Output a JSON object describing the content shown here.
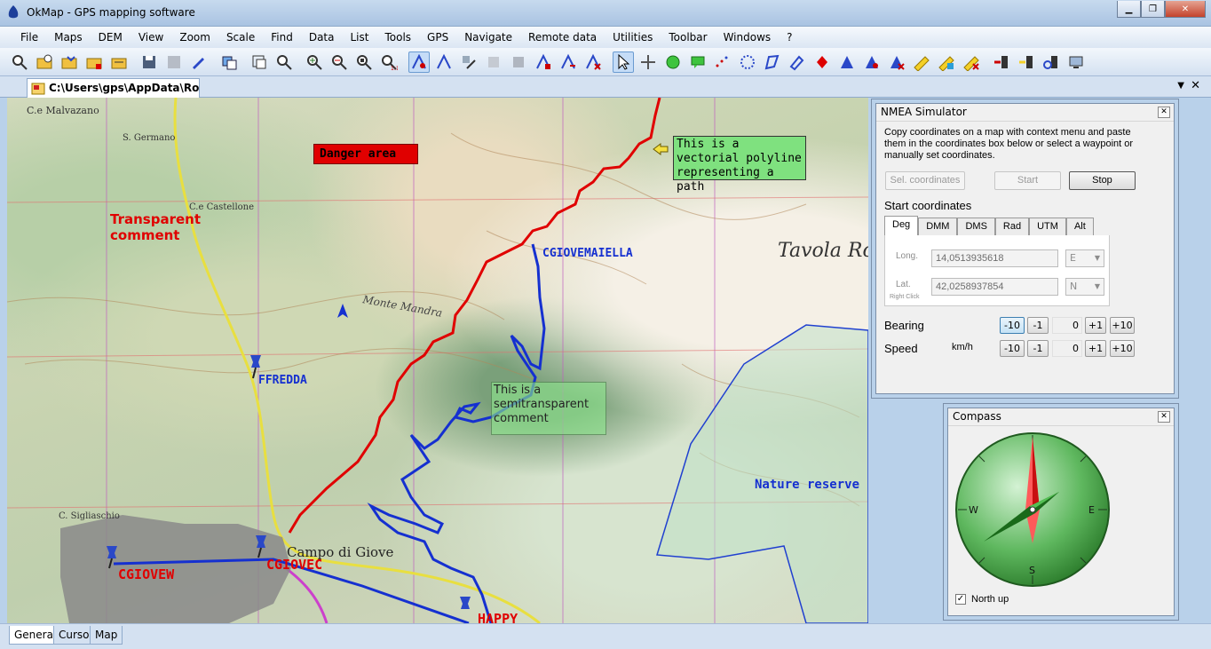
{
  "window": {
    "title": "OkMap - GPS mapping software"
  },
  "menu": [
    "File",
    "Maps",
    "DEM",
    "View",
    "Zoom",
    "Scale",
    "Find",
    "Data",
    "List",
    "Tools",
    "GPS",
    "Navigate",
    "Remote data",
    "Utilities",
    "Toolbar",
    "Windows",
    "?"
  ],
  "document": {
    "tab_label": "C:\\Users\\gps\\AppData\\Roa..."
  },
  "map": {
    "annotations": {
      "danger": "Danger area",
      "polyline": "This is a vectorial polyline representing a path",
      "semi": "This is a semitransparent comment",
      "transparent": "Transparent comment",
      "nature": "Nature reserve"
    },
    "waypoints": {
      "cgiovemaiella": "CGIOVEMAIELLA",
      "ffredda": "FFREDDA",
      "cgiovew": "CGIOVEW",
      "cgiovec": "CGIOVEC",
      "happy": "HAPPY"
    },
    "places": {
      "campo": "Campo di Giove",
      "tavola": "Tavola Ro",
      "malvazano": "C.e Malvazano",
      "germano": "S. Germano",
      "castellone": "C.e Castellone",
      "monte_mandra": "Monte Mandra",
      "sigliaschio": "C. Sigliaschio"
    }
  },
  "nmea": {
    "title": "NMEA Simulator",
    "description": "Copy coordinates on a map with context menu and paste them in the coordinates box below or select a waypoint or manually set coordinates.",
    "buttons": {
      "select": "Sel. coordinates",
      "start": "Start",
      "stop": "Stop"
    },
    "start_coordinates_label": "Start coordinates",
    "coord_tabs": [
      "Deg",
      "DMM",
      "DMS",
      "Rad",
      "UTM",
      "Alt"
    ],
    "long_label": "Long.",
    "long_value": "14,0513935618",
    "long_dir": "E",
    "lat_label": "Lat.",
    "lat_value": "42,0258937854",
    "lat_dir": "N",
    "right_click_hint": "Right Click",
    "bearing_label": "Bearing",
    "bearing_value": "0",
    "speed_label": "Speed",
    "speed_unit": "km/h",
    "speed_value": "0",
    "step_buttons": [
      "-10",
      "-1",
      "+1",
      "+10"
    ]
  },
  "compass": {
    "title": "Compass",
    "north_up_label": "North up",
    "north_up_checked": true,
    "cardinals": {
      "w": "W",
      "e": "E",
      "s": "S"
    }
  },
  "bottom_tabs": [
    "General",
    "Cursor",
    "Map"
  ]
}
